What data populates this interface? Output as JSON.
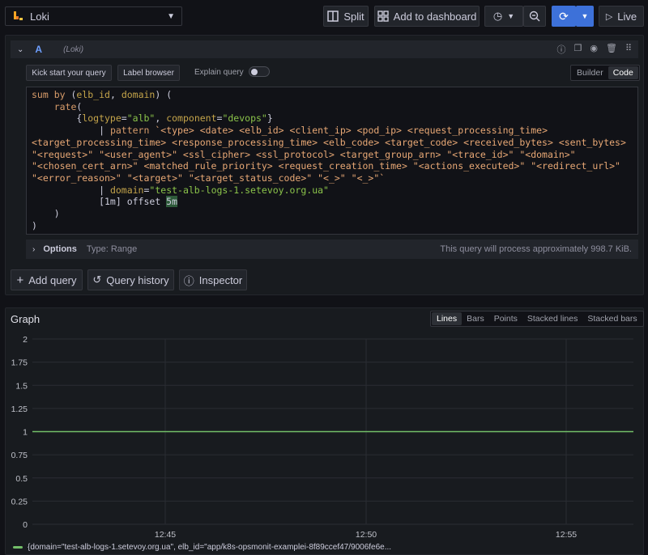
{
  "topbar": {
    "datasource": "Loki",
    "split_label": "Split",
    "add_dashboard_label": "Add to dashboard",
    "live_label": "Live"
  },
  "query": {
    "ref": "A",
    "datasource_hint": "(Loki)",
    "kick_start_label": "Kick start your query",
    "label_browser_label": "Label browser",
    "explain_label": "Explain query",
    "mode_builder": "Builder",
    "mode_code": "Code",
    "options_label": "Options",
    "options_type": "Type: Range",
    "process_info": "This query will process approximately 998.7 KiB."
  },
  "actions": {
    "add_query": "Add query",
    "query_history": "Query history",
    "inspector": "Inspector"
  },
  "graph": {
    "title": "Graph",
    "styles": [
      "Lines",
      "Bars",
      "Points",
      "Stacked lines",
      "Stacked bars"
    ],
    "active_style": "Lines",
    "legend_text": "{domain=\"test-alb-logs-1.setevoy.org.ua\", elb_id=\"app/k8s-opsmonit-examplei-8f89ccef47/9006fe6e..."
  },
  "chart_data": {
    "type": "line",
    "x": [
      "12:45",
      "12:50",
      "12:55"
    ],
    "y_ticks": [
      0,
      0.25,
      0.5,
      0.75,
      1,
      1.25,
      1.5,
      1.75,
      2
    ],
    "ylim": [
      0,
      2
    ],
    "series": [
      {
        "values": [
          1,
          1,
          1
        ]
      }
    ],
    "colors": {
      "series": "#73bf69"
    },
    "grid": true,
    "legend": "bottom-left"
  }
}
